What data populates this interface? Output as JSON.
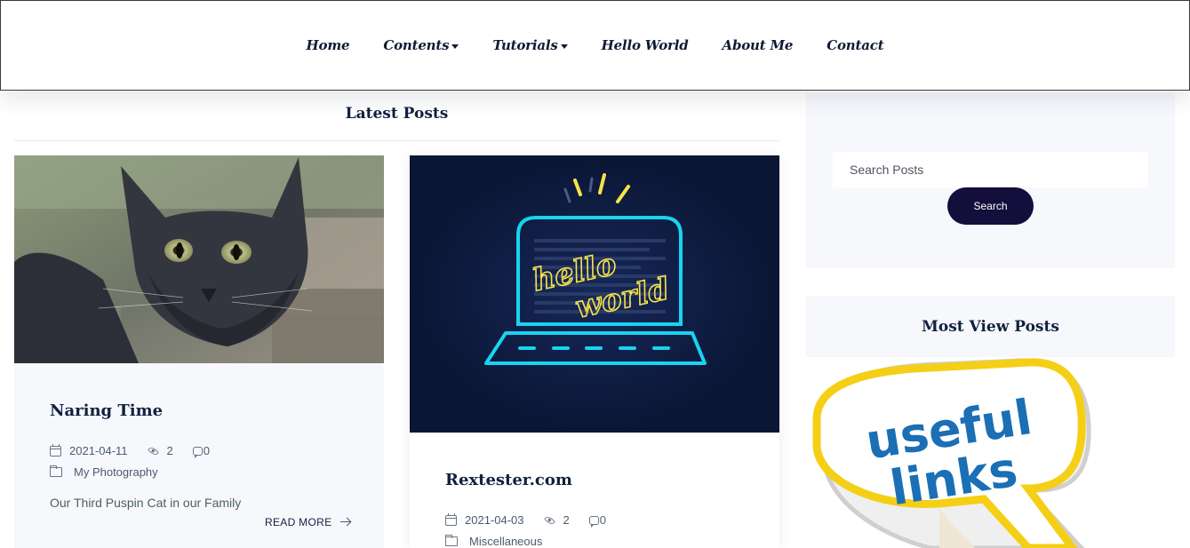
{
  "nav": {
    "items": [
      {
        "label": "Home",
        "dropdown": false
      },
      {
        "label": "Contents",
        "dropdown": true
      },
      {
        "label": "Tutorials",
        "dropdown": true
      },
      {
        "label": "Hello World",
        "dropdown": false
      },
      {
        "label": "About Me",
        "dropdown": false
      },
      {
        "label": "Contact",
        "dropdown": false
      }
    ]
  },
  "main": {
    "section_title": "Latest Posts",
    "posts": [
      {
        "title": "Naring Time",
        "date": "2021-04-11",
        "views": "2",
        "comments": "0",
        "category": "My Photography",
        "excerpt": "Our Third Puspin Cat in our Family",
        "read_more": "READ MORE"
      },
      {
        "title": "Rextester.com",
        "date": "2021-04-03",
        "views": "2",
        "comments": "0",
        "category": "Miscellaneous",
        "image_text_1": "hello",
        "image_text_2": "world"
      }
    ]
  },
  "sidebar": {
    "search": {
      "placeholder": "Search Posts",
      "button_label": "Search"
    },
    "most_viewed": {
      "title": "Most View Posts",
      "image_text_1": "useful",
      "image_text_2": "links"
    }
  },
  "colors": {
    "brand_dark": "#140e3c",
    "heading": "#10213f",
    "card_bg": "#f7f8fc",
    "neon_cyan": "#19d3f0",
    "neon_yellow": "#f6e34a"
  }
}
